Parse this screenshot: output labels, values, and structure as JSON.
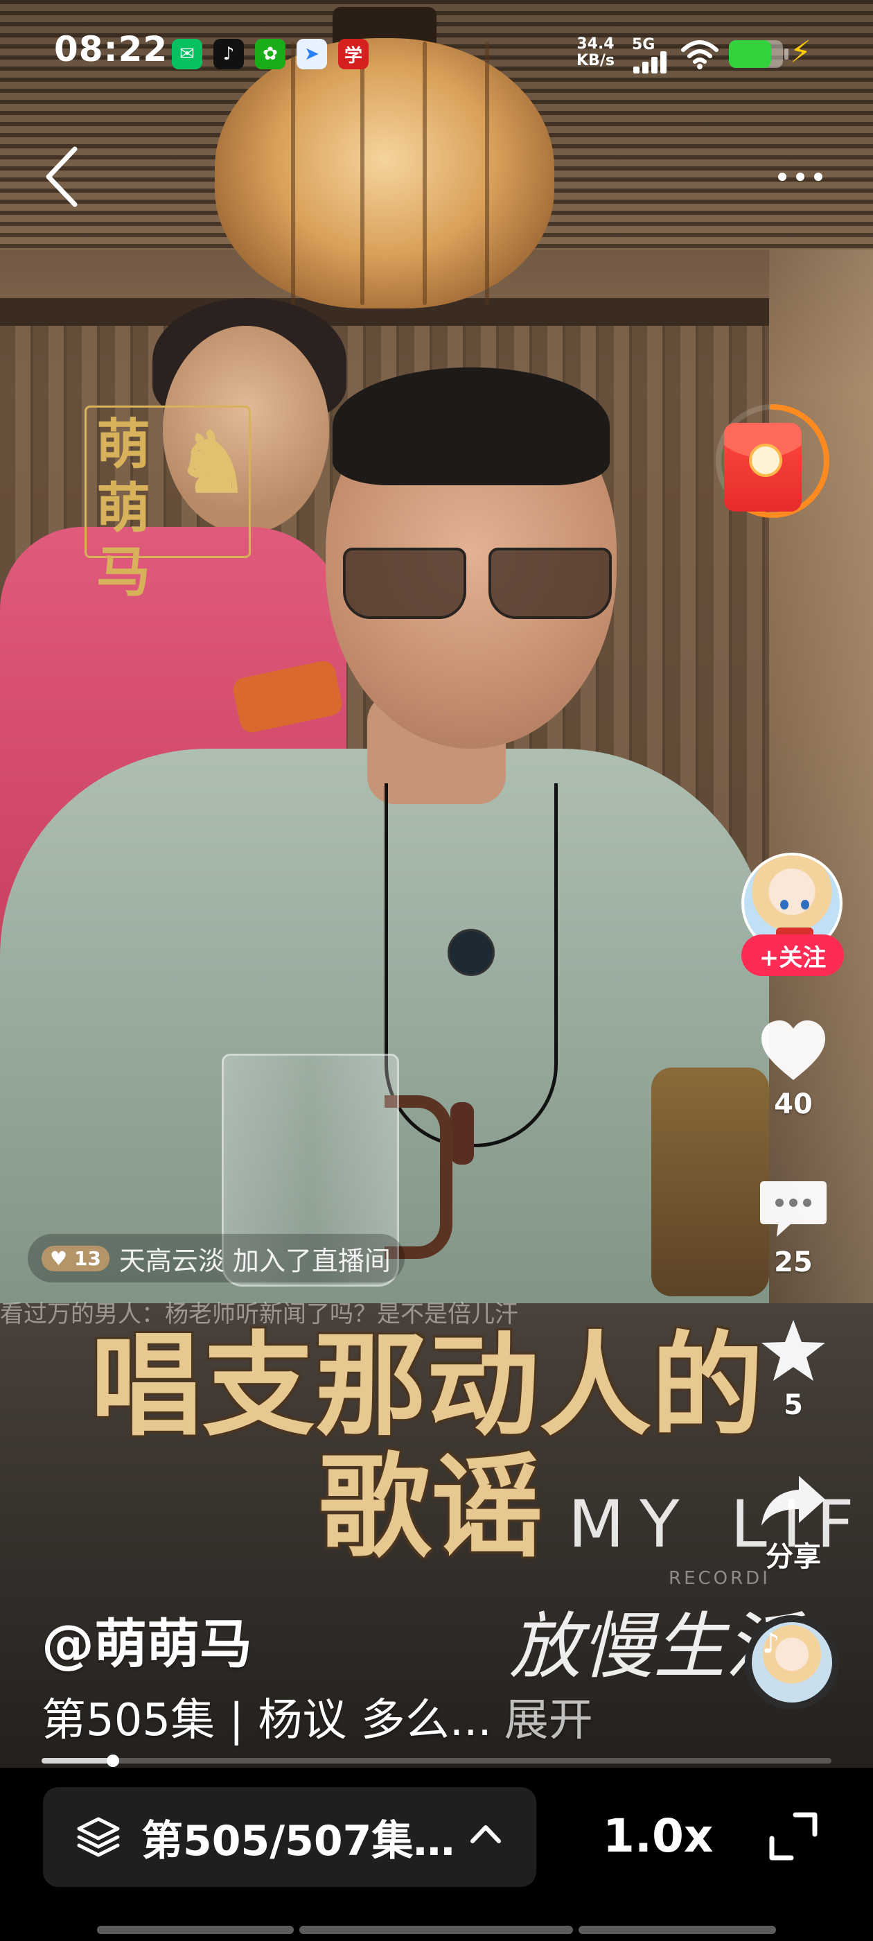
{
  "status_bar": {
    "time": "08:22",
    "net_speed_value": "34.4",
    "net_speed_unit": "KB/s",
    "network": "5G",
    "app_icons": [
      {
        "name": "wechat-icon",
        "color": "#07c160",
        "glyph": "✉"
      },
      {
        "name": "douyin-icon",
        "color": "#111111",
        "glyph": "♪"
      },
      {
        "name": "green-app-icon",
        "color": "#1aad19",
        "glyph": "✿"
      },
      {
        "name": "feishu-icon",
        "color": "#e8f1ff",
        "glyph": "➤"
      },
      {
        "name": "red-app-icon",
        "color": "#d61f1f",
        "glyph": "学"
      }
    ],
    "battery_level": 0.78,
    "battery_color": "#33d13b"
  },
  "video": {
    "watermark": "萌萌马",
    "join_message": {
      "level": "13",
      "text": "天高云淡 加入了直播间"
    },
    "ghost_comment": "看过万的男人：杨老师听新闻了吗？是不是倍儿汗",
    "subtitle_line1": "唱支那动人的",
    "subtitle_line2": "歌谣",
    "brand_text": "MY LIFE",
    "brand_sub": "RECORDI",
    "brand_script": "放慢生活"
  },
  "red_packet": {
    "icon": "red-envelope-icon",
    "ring_progress": 0.65,
    "ring_color": "#ff8a1f"
  },
  "rail": {
    "follow_label": "+关注",
    "like_count": "40",
    "comment_count": "25",
    "favorite_count": "5",
    "share_label": "分享"
  },
  "caption": {
    "author": "@萌萌马",
    "description": "第505集 | 杨议 多么...",
    "expand_label": "展开"
  },
  "progress": {
    "played_fraction": 0.09
  },
  "bottom_bar": {
    "episode_label": "第505/507集…",
    "speed_label": "1.0x"
  },
  "colors": {
    "follow_red": "#fe2c55",
    "subtitle_gold": "#e8c891"
  }
}
